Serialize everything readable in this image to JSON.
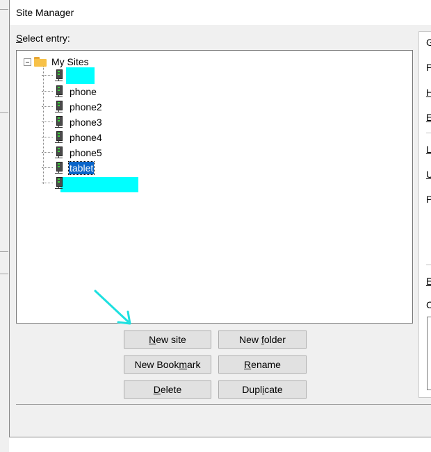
{
  "window": {
    "title": "Site Manager"
  },
  "tree": {
    "label": "Select entry:",
    "root": {
      "label": "My Sites",
      "icon": "folder-icon",
      "expanded": true
    },
    "items": [
      {
        "label": "",
        "redacted": true
      },
      {
        "label": "phone"
      },
      {
        "label": "phone2"
      },
      {
        "label": "phone3"
      },
      {
        "label": "phone4"
      },
      {
        "label": "phone5"
      },
      {
        "label": "tablet",
        "selected": true
      },
      {
        "label": "",
        "redacted": true
      }
    ]
  },
  "buttons": {
    "new_site": "New site",
    "new_folder": "New folder",
    "new_bookmark": "New Bookmark",
    "rename": "Rename",
    "delete": "Delete",
    "duplicate": "Duplicate"
  },
  "right_panel": {
    "tab_letter": "G",
    "letters": [
      "P",
      "H",
      "E",
      "L",
      "U",
      "P",
      "E",
      "C"
    ]
  },
  "annotation": {
    "arrow_color": "#1ee0e0",
    "redaction_color": "#00ffff"
  },
  "colors": {
    "selection": "#0a64c8"
  }
}
